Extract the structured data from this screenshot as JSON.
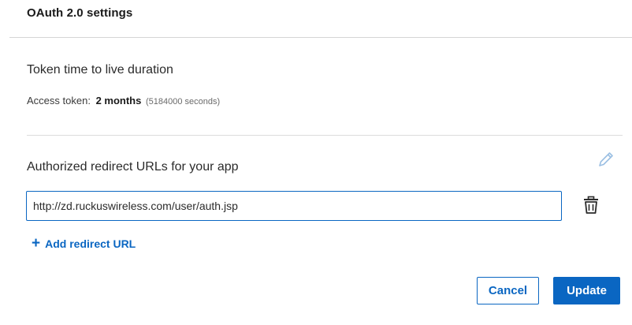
{
  "header": {
    "title": "OAuth 2.0 settings"
  },
  "token_ttl": {
    "title": "Token time to live duration",
    "access_label": "Access token:",
    "access_value": "2 months",
    "access_seconds": "(5184000 seconds)"
  },
  "redirect": {
    "title": "Authorized redirect URLs for your app",
    "edit_icon": "pencil-icon",
    "urls": [
      {
        "value": "http://zd.ruckuswireless.com/user/auth.jsp",
        "delete_icon": "trash-icon"
      }
    ],
    "add_label": "Add redirect URL"
  },
  "actions": {
    "cancel_label": "Cancel",
    "update_label": "Update"
  },
  "colors": {
    "accent": "#0a66c2",
    "divider": "#d6d6d6",
    "edit_icon": "#9bbfe3"
  }
}
